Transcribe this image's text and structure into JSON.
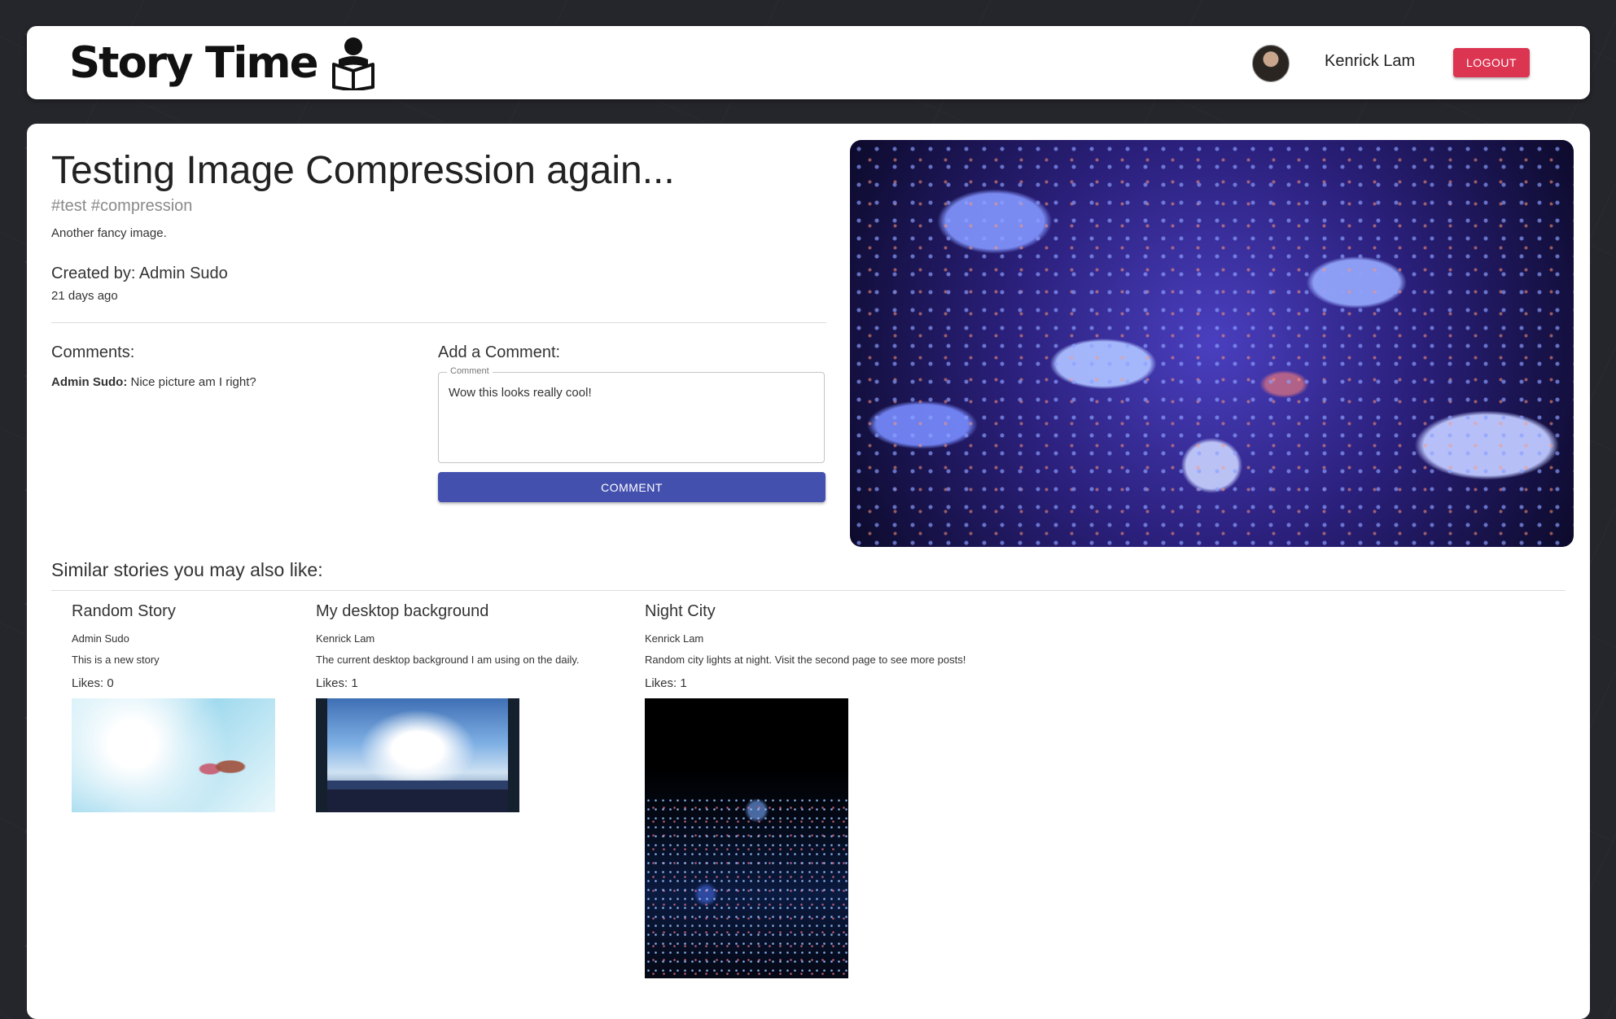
{
  "header": {
    "logo_text": "Story Time",
    "user_name": "Kenrick Lam",
    "logout_label": "LOGOUT"
  },
  "story": {
    "title": "Testing Image Compression again...",
    "tags": "#test #compression",
    "description": "Another fancy image.",
    "created_by": "Created by: Admin Sudo",
    "age": "21 days ago"
  },
  "comments": {
    "heading": "Comments:",
    "items": [
      {
        "author": "Admin Sudo:",
        "text": " Nice picture am I right?"
      }
    ]
  },
  "add_comment": {
    "heading": "Add a Comment:",
    "field_label": "Comment",
    "value": "Wow this looks really cool!",
    "button_label": "COMMENT"
  },
  "similar": {
    "heading": "Similar stories you may also like:",
    "stories": [
      {
        "title": "Random Story",
        "author": "Admin Sudo",
        "description": "This is a new story",
        "likes": "Likes: 0"
      },
      {
        "title": "My desktop background",
        "author": "Kenrick Lam",
        "description": "The current desktop background I am using on the daily.",
        "likes": "Likes: 1"
      },
      {
        "title": "Night City",
        "author": "Kenrick Lam",
        "description": "Random city lights at night. Visit the second page to see more posts!",
        "likes": "Likes: 1"
      }
    ]
  }
}
